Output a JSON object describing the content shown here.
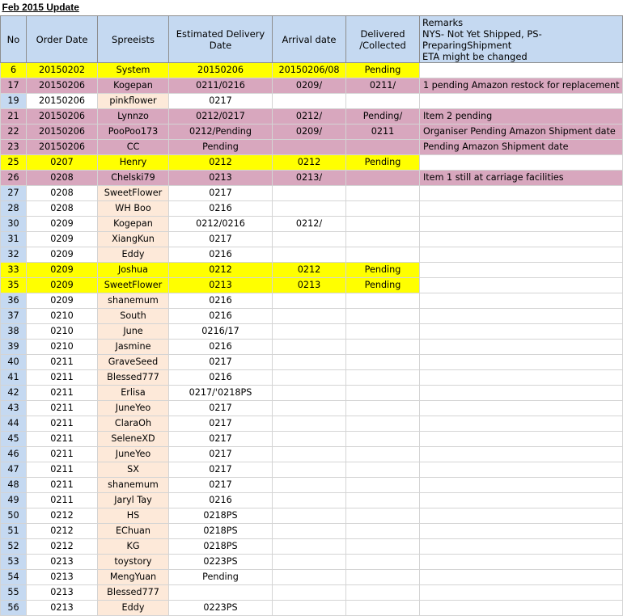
{
  "sheet_title": "Feb 2015 Update",
  "headers": {
    "no": "No",
    "order_date": "Order Date",
    "spreeists": "Spreeists",
    "estimated_delivery": "Estimated Delivery Date",
    "arrival": "Arrival date",
    "delivered": "Delivered /Collected",
    "remarks_line1": "Remarks",
    "remarks_line2": "NYS- Not Yet Shipped, PS-PreparingShipment",
    "remarks_line3": "ETA might be changed"
  },
  "highlight_colors": {
    "yellow": "#ffff00",
    "pink": "#d8a7be",
    "header_blue": "#c5d9f1",
    "name_peach": "#fde9d9"
  },
  "rows": [
    {
      "no": "6",
      "order": "20150202",
      "name": "System",
      "est": "20150206",
      "arrival": "20150206/08",
      "delivered": "Pending",
      "remark": "",
      "hl": "yellow"
    },
    {
      "no": "17",
      "order": "20150206",
      "name": "Kogepan",
      "est": "0211/0216",
      "arrival": "0209/",
      "delivered": "0211/",
      "remark": "1 pending Amazon restock for replacement",
      "hl": "pink"
    },
    {
      "no": "19",
      "order": "20150206",
      "name": "pinkflower",
      "est": "0217",
      "arrival": "",
      "delivered": "",
      "remark": "",
      "hl": ""
    },
    {
      "no": "21",
      "order": "20150206",
      "name": "Lynnzo",
      "est": "0212/0217",
      "arrival": "0212/",
      "delivered": "Pending/",
      "remark": "Item 2 pending",
      "hl": "pink"
    },
    {
      "no": "22",
      "order": "20150206",
      "name": "PooPoo173",
      "est": "0212/Pending",
      "arrival": "0209/",
      "delivered": "0211",
      "remark": "Organiser Pending Amazon Shipment date",
      "hl": "pink"
    },
    {
      "no": "23",
      "order": "20150206",
      "name": "CC",
      "est": "Pending",
      "arrival": "",
      "delivered": "",
      "remark": "Pending Amazon Shipment date",
      "hl": "pink"
    },
    {
      "no": "25",
      "order": "0207",
      "name": "Henry",
      "est": "0212",
      "arrival": "0212",
      "delivered": "Pending",
      "remark": "",
      "hl": "yellow"
    },
    {
      "no": "26",
      "order": "0208",
      "name": "Chelski79",
      "est": "0213",
      "arrival": "0213/",
      "delivered": "",
      "remark": "Item 1 still at carriage facilities",
      "hl": "pink"
    },
    {
      "no": "27",
      "order": "0208",
      "name": "SweetFlower",
      "est": "0217",
      "arrival": "",
      "delivered": "",
      "remark": "",
      "hl": ""
    },
    {
      "no": "28",
      "order": "0208",
      "name": "WH Boo",
      "est": "0216",
      "arrival": "",
      "delivered": "",
      "remark": "",
      "hl": ""
    },
    {
      "no": "30",
      "order": "0209",
      "name": "Kogepan",
      "est": "0212/0216",
      "arrival": "0212/",
      "delivered": "",
      "remark": "",
      "hl": ""
    },
    {
      "no": "31",
      "order": "0209",
      "name": "XiangKun",
      "est": "0217",
      "arrival": "",
      "delivered": "",
      "remark": "",
      "hl": ""
    },
    {
      "no": "32",
      "order": "0209",
      "name": "Eddy",
      "est": "0216",
      "arrival": "",
      "delivered": "",
      "remark": "",
      "hl": ""
    },
    {
      "no": "33",
      "order": "0209",
      "name": "Joshua",
      "est": "0212",
      "arrival": "0212",
      "delivered": "Pending",
      "remark": "",
      "hl": "yellow"
    },
    {
      "no": "35",
      "order": "0209",
      "name": "SweetFlower",
      "est": "0213",
      "arrival": "0213",
      "delivered": "Pending",
      "remark": "",
      "hl": "yellow"
    },
    {
      "no": "36",
      "order": "0209",
      "name": "shanemum",
      "est": "0216",
      "arrival": "",
      "delivered": "",
      "remark": "",
      "hl": ""
    },
    {
      "no": "37",
      "order": "0210",
      "name": "South",
      "est": "0216",
      "arrival": "",
      "delivered": "",
      "remark": "",
      "hl": ""
    },
    {
      "no": "38",
      "order": "0210",
      "name": "June",
      "est": "0216/17",
      "arrival": "",
      "delivered": "",
      "remark": "",
      "hl": ""
    },
    {
      "no": "39",
      "order": "0210",
      "name": "Jasmine",
      "est": "0216",
      "arrival": "",
      "delivered": "",
      "remark": "",
      "hl": ""
    },
    {
      "no": "40",
      "order": "0211",
      "name": "GraveSeed",
      "est": "0217",
      "arrival": "",
      "delivered": "",
      "remark": "",
      "hl": ""
    },
    {
      "no": "41",
      "order": "0211",
      "name": "Blessed777",
      "est": "0216",
      "arrival": "",
      "delivered": "",
      "remark": "",
      "hl": ""
    },
    {
      "no": "42",
      "order": "0211",
      "name": "Erlisa",
      "est": "0217/'0218PS",
      "arrival": "",
      "delivered": "",
      "remark": "",
      "hl": ""
    },
    {
      "no": "43",
      "order": "0211",
      "name": "JuneYeo",
      "est": "0217",
      "arrival": "",
      "delivered": "",
      "remark": "",
      "hl": ""
    },
    {
      "no": "44",
      "order": "0211",
      "name": "ClaraOh",
      "est": "0217",
      "arrival": "",
      "delivered": "",
      "remark": "",
      "hl": ""
    },
    {
      "no": "45",
      "order": "0211",
      "name": "SeleneXD",
      "est": "0217",
      "arrival": "",
      "delivered": "",
      "remark": "",
      "hl": ""
    },
    {
      "no": "46",
      "order": "0211",
      "name": "JuneYeo",
      "est": "0217",
      "arrival": "",
      "delivered": "",
      "remark": "",
      "hl": ""
    },
    {
      "no": "47",
      "order": "0211",
      "name": "SX",
      "est": "0217",
      "arrival": "",
      "delivered": "",
      "remark": "",
      "hl": ""
    },
    {
      "no": "48",
      "order": "0211",
      "name": "shanemum",
      "est": "0217",
      "arrival": "",
      "delivered": "",
      "remark": "",
      "hl": ""
    },
    {
      "no": "49",
      "order": "0211",
      "name": "Jaryl Tay",
      "est": "0216",
      "arrival": "",
      "delivered": "",
      "remark": "",
      "hl": ""
    },
    {
      "no": "50",
      "order": "0212",
      "name": "HS",
      "est": "0218PS",
      "arrival": "",
      "delivered": "",
      "remark": "",
      "hl": ""
    },
    {
      "no": "51",
      "order": "0212",
      "name": "EChuan",
      "est": "0218PS",
      "arrival": "",
      "delivered": "",
      "remark": "",
      "hl": ""
    },
    {
      "no": "52",
      "order": "0212",
      "name": "KG",
      "est": "0218PS",
      "arrival": "",
      "delivered": "",
      "remark": "",
      "hl": ""
    },
    {
      "no": "53",
      "order": "0213",
      "name": "toystory",
      "est": "0223PS",
      "arrival": "",
      "delivered": "",
      "remark": "",
      "hl": ""
    },
    {
      "no": "54",
      "order": "0213",
      "name": "MengYuan",
      "est": "Pending",
      "arrival": "",
      "delivered": "",
      "remark": "",
      "hl": ""
    },
    {
      "no": "55",
      "order": "0213",
      "name": "Blessed777",
      "est": "",
      "arrival": "",
      "delivered": "",
      "remark": "",
      "hl": ""
    },
    {
      "no": "56",
      "order": "0213",
      "name": "Eddy",
      "est": "0223PS",
      "arrival": "",
      "delivered": "",
      "remark": "",
      "hl": ""
    }
  ]
}
